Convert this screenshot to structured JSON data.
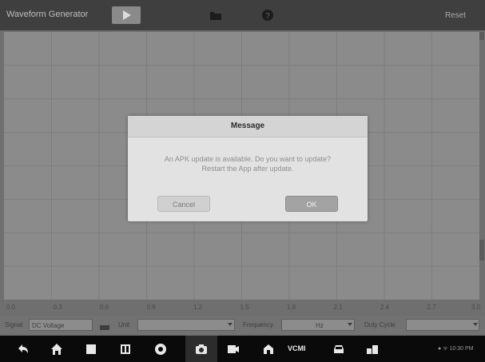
{
  "header": {
    "title": "Waveform Generator",
    "reset_label": "Reset"
  },
  "icons": {
    "play": "play-icon",
    "folder": "folder-icon",
    "help": "help-icon"
  },
  "plot": {
    "x_ticks": [
      "0.0",
      "0.3",
      "0.6",
      "0.9",
      "1.2",
      "1.5",
      "1.8",
      "2.1",
      "2.4",
      "2.7",
      "3.0"
    ]
  },
  "controls": {
    "signal_label": "Signal",
    "signal_value": "DC Voltage",
    "unit_label": "Unit",
    "unit_value": "",
    "frequency_label": "Frequency",
    "frequency_value": "Hz",
    "duty_cycle_label": "Duty Cycle",
    "duty_cycle_value": ""
  },
  "dialog": {
    "title": "Message",
    "line1": "An APK update is available. Do you want to update?",
    "line2": "Restart the App after update.",
    "cancel_label": "Cancel",
    "ok_label": "OK"
  },
  "navbar": {
    "items": [
      "back-icon",
      "home-icon",
      "recent-apps-icon",
      "apps-grid-icon",
      "browser-icon",
      "camera-icon",
      "screen-record-icon",
      "toolbox-icon",
      "vcmi-icon",
      "vehicle-icon",
      "shop-icon"
    ],
    "vcmi_label": "VCMI",
    "status_text": "● ᯤ 10:30 PM"
  }
}
